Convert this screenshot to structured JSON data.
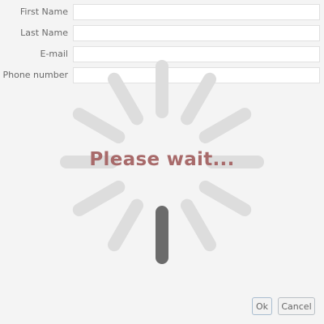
{
  "form": {
    "fields": [
      {
        "label": "First Name",
        "value": ""
      },
      {
        "label": "Last Name",
        "value": ""
      },
      {
        "label": "E-mail",
        "value": ""
      },
      {
        "label": "Phone number",
        "value": ""
      }
    ]
  },
  "overlay": {
    "message": "Please wait...",
    "spoke_color": "#dddddd",
    "active_color": "#6b6b6b",
    "text_color": "#a86a6a"
  },
  "buttons": {
    "ok": "Ok",
    "cancel": "Cancel"
  }
}
